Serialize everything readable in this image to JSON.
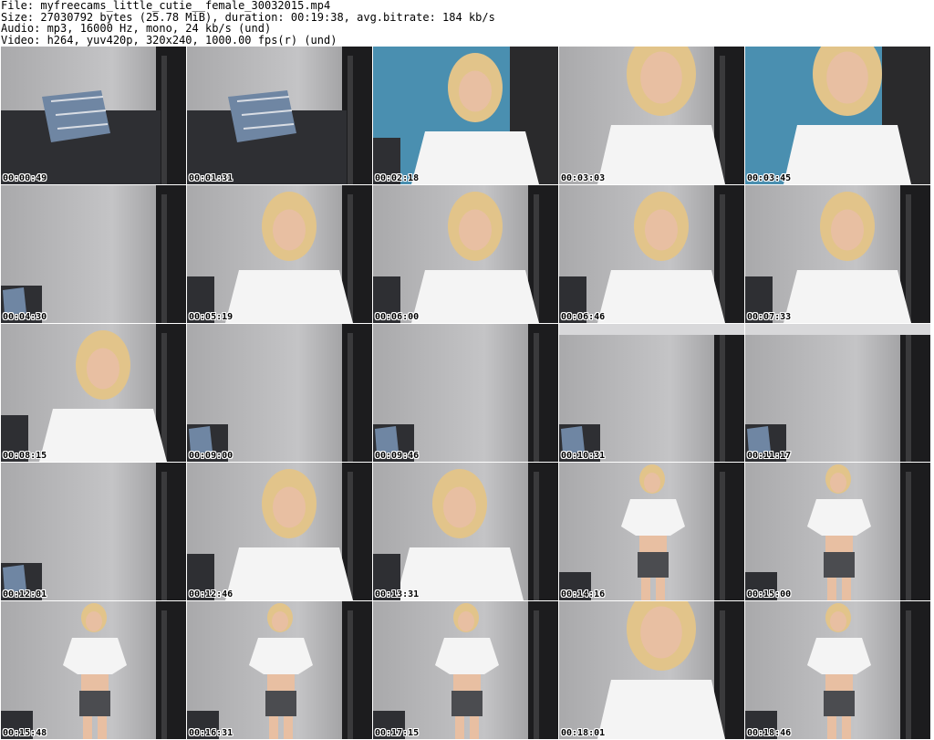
{
  "header": {
    "file_line": "File: myfreecams_little_cutie__female_30032015.mp4",
    "size_line": "Size: 27030792 bytes (25.78 MiB), duration: 00:19:38, avg.bitrate: 184 kb/s",
    "audio_line": "Audio: mp3, 16000 Hz, mono, 24 kb/s (und)",
    "video_line": "Video: h264, yuv420p, 320x240, 1000.00 fps(r) (und)"
  },
  "thumbnails": [
    {
      "time": "00:00:49",
      "scene": "room-pillow"
    },
    {
      "time": "00:01:31",
      "scene": "room-pillow"
    },
    {
      "time": "00:02:18",
      "scene": "person-blue"
    },
    {
      "time": "00:03:03",
      "scene": "person-close"
    },
    {
      "time": "00:03:45",
      "scene": "person-close-blue"
    },
    {
      "time": "00:04:30",
      "scene": "room-empty"
    },
    {
      "time": "00:05:19",
      "scene": "person-seated"
    },
    {
      "time": "00:06:00",
      "scene": "person-seated"
    },
    {
      "time": "00:06:46",
      "scene": "person-seated"
    },
    {
      "time": "00:07:33",
      "scene": "person-seated"
    },
    {
      "time": "00:08:15",
      "scene": "person-seated"
    },
    {
      "time": "00:09:00",
      "scene": "room-empty"
    },
    {
      "time": "00:09:46",
      "scene": "room-empty"
    },
    {
      "time": "00:10:31",
      "scene": "room-door"
    },
    {
      "time": "00:11:17",
      "scene": "room-door"
    },
    {
      "time": "00:12:01",
      "scene": "room-empty"
    },
    {
      "time": "00:12:46",
      "scene": "person-seated"
    },
    {
      "time": "00:13:31",
      "scene": "person-lean"
    },
    {
      "time": "00:14:16",
      "scene": "person-standing"
    },
    {
      "time": "00:15:00",
      "scene": "person-standing"
    },
    {
      "time": "00:15:48",
      "scene": "person-standing"
    },
    {
      "time": "00:16:31",
      "scene": "person-standing"
    },
    {
      "time": "00:17:15",
      "scene": "person-standing"
    },
    {
      "time": "00:18:01",
      "scene": "person-close"
    },
    {
      "time": "00:18:46",
      "scene": "person-standing"
    }
  ],
  "colors": {
    "wall": "#b7b7b9",
    "door": "#1c1c1e",
    "sofa": "#2e2f33",
    "pillow": "#6f86a3",
    "shirt": "#f4f4f4",
    "hair": "#e2c48a",
    "skin": "#e8bfa2",
    "shorts": "#4b4c50",
    "blue_bg": "#4a8fb0"
  }
}
